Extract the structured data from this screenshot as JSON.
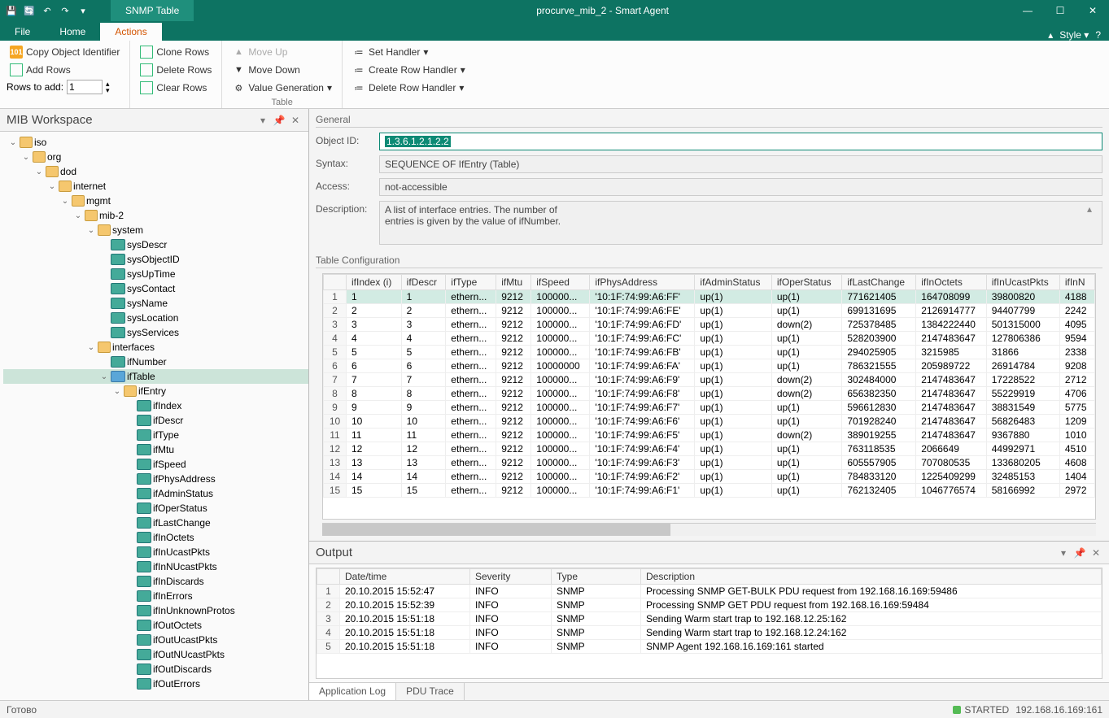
{
  "window": {
    "context_tab": "SNMP Table",
    "title": "procurve_mib_2 - Smart Agent",
    "style": "Style"
  },
  "menu": {
    "file": "File",
    "home": "Home",
    "actions": "Actions"
  },
  "ribbon": {
    "copy_oid": "Copy Object Identifier",
    "add_rows": "Add Rows",
    "rows_to_add": "Rows to add:",
    "rows_value": "1",
    "clone": "Clone Rows",
    "delete": "Delete Rows",
    "clear": "Clear Rows",
    "moveup": "Move Up",
    "movedown": "Move Down",
    "valgen": "Value Generation",
    "sethandler": "Set Handler",
    "createrow": "Create Row Handler",
    "deleterow": "Delete Row Handler",
    "grouplabel": "Table"
  },
  "mib": {
    "title": "MIB Workspace",
    "nodes": {
      "iso": "iso",
      "org": "org",
      "dod": "dod",
      "internet": "internet",
      "mgmt": "mgmt",
      "mib2": "mib-2",
      "system": "system",
      "sysDescr": "sysDescr",
      "sysObjectID": "sysObjectID",
      "sysUpTime": "sysUpTime",
      "sysContact": "sysContact",
      "sysName": "sysName",
      "sysLocation": "sysLocation",
      "sysServices": "sysServices",
      "interfaces": "interfaces",
      "ifNumber": "ifNumber",
      "ifTable": "ifTable",
      "ifEntry": "ifEntry",
      "ifIndex": "ifIndex",
      "ifDescr": "ifDescr",
      "ifType": "ifType",
      "ifMtu": "ifMtu",
      "ifSpeed": "ifSpeed",
      "ifPhysAddress": "ifPhysAddress",
      "ifAdminStatus": "ifAdminStatus",
      "ifOperStatus": "ifOperStatus",
      "ifLastChange": "ifLastChange",
      "ifInOctets": "ifInOctets",
      "ifInUcastPkts": "ifInUcastPkts",
      "ifInNUcastPkts": "ifInNUcastPkts",
      "ifInDiscards": "ifInDiscards",
      "ifInErrors": "ifInErrors",
      "ifInUnknownProtos": "ifInUnknownProtos",
      "ifOutOctets": "ifOutOctets",
      "ifOutUcastPkts": "ifOutUcastPkts",
      "ifOutNUcastPkts": "ifOutNUcastPkts",
      "ifOutDiscards": "ifOutDiscards",
      "ifOutErrors": "ifOutErrors"
    }
  },
  "general": {
    "title": "General",
    "object_id_lbl": "Object ID:",
    "object_id": "1.3.6.1.2.1.2.2",
    "syntax_lbl": "Syntax:",
    "syntax": "SEQUENCE OF IfEntry (Table)",
    "access_lbl": "Access:",
    "access": "not-accessible",
    "desc_lbl": "Description:",
    "desc": "A list of interface entries. The number of\nentries is given by the value of ifNumber."
  },
  "tablecfg": {
    "title": "Table Configuration",
    "cols": [
      "ifIndex (i)",
      "ifDescr",
      "ifType",
      "ifMtu",
      "ifSpeed",
      "ifPhysAddress",
      "ifAdminStatus",
      "ifOperStatus",
      "ifLastChange",
      "ifInOctets",
      "ifInUcastPkts",
      "ifInN"
    ],
    "rows": [
      [
        "1",
        "1",
        "ethern...",
        "9212",
        "100000...",
        "'10:1F:74:99:A6:FF'",
        "up(1)",
        "up(1)",
        "771621405",
        "164708099",
        "39800820",
        "4188"
      ],
      [
        "2",
        "2",
        "ethern...",
        "9212",
        "100000...",
        "'10:1F:74:99:A6:FE'",
        "up(1)",
        "up(1)",
        "699131695",
        "2126914777",
        "94407799",
        "2242"
      ],
      [
        "3",
        "3",
        "ethern...",
        "9212",
        "100000...",
        "'10:1F:74:99:A6:FD'",
        "up(1)",
        "down(2)",
        "725378485",
        "1384222440",
        "501315000",
        "4095"
      ],
      [
        "4",
        "4",
        "ethern...",
        "9212",
        "100000...",
        "'10:1F:74:99:A6:FC'",
        "up(1)",
        "up(1)",
        "528203900",
        "2147483647",
        "127806386",
        "9594"
      ],
      [
        "5",
        "5",
        "ethern...",
        "9212",
        "100000...",
        "'10:1F:74:99:A6:FB'",
        "up(1)",
        "up(1)",
        "294025905",
        "3215985",
        "31866",
        "2338"
      ],
      [
        "6",
        "6",
        "ethern...",
        "9212",
        "10000000",
        "'10:1F:74:99:A6:FA'",
        "up(1)",
        "up(1)",
        "786321555",
        "205989722",
        "26914784",
        "9208"
      ],
      [
        "7",
        "7",
        "ethern...",
        "9212",
        "100000...",
        "'10:1F:74:99:A6:F9'",
        "up(1)",
        "down(2)",
        "302484000",
        "2147483647",
        "17228522",
        "2712"
      ],
      [
        "8",
        "8",
        "ethern...",
        "9212",
        "100000...",
        "'10:1F:74:99:A6:F8'",
        "up(1)",
        "down(2)",
        "656382350",
        "2147483647",
        "55229919",
        "4706"
      ],
      [
        "9",
        "9",
        "ethern...",
        "9212",
        "100000...",
        "'10:1F:74:99:A6:F7'",
        "up(1)",
        "up(1)",
        "596612830",
        "2147483647",
        "38831549",
        "5775"
      ],
      [
        "10",
        "10",
        "ethern...",
        "9212",
        "100000...",
        "'10:1F:74:99:A6:F6'",
        "up(1)",
        "up(1)",
        "701928240",
        "2147483647",
        "56826483",
        "1209"
      ],
      [
        "11",
        "11",
        "ethern...",
        "9212",
        "100000...",
        "'10:1F:74:99:A6:F5'",
        "up(1)",
        "down(2)",
        "389019255",
        "2147483647",
        "9367880",
        "1010"
      ],
      [
        "12",
        "12",
        "ethern...",
        "9212",
        "100000...",
        "'10:1F:74:99:A6:F4'",
        "up(1)",
        "up(1)",
        "763118535",
        "2066649",
        "44992971",
        "4510"
      ],
      [
        "13",
        "13",
        "ethern...",
        "9212",
        "100000...",
        "'10:1F:74:99:A6:F3'",
        "up(1)",
        "up(1)",
        "605557905",
        "707080535",
        "133680205",
        "4608"
      ],
      [
        "14",
        "14",
        "ethern...",
        "9212",
        "100000...",
        "'10:1F:74:99:A6:F2'",
        "up(1)",
        "up(1)",
        "784833120",
        "1225409299",
        "32485153",
        "1404"
      ],
      [
        "15",
        "15",
        "ethern...",
        "9212",
        "100000...",
        "'10:1F:74:99:A6:F1'",
        "up(1)",
        "up(1)",
        "762132405",
        "1046776574",
        "58166992",
        "2972"
      ]
    ]
  },
  "output": {
    "title": "Output",
    "cols": [
      "Date/time",
      "Severity",
      "Type",
      "Description"
    ],
    "rows": [
      [
        "20.10.2015 15:52:47",
        "INFO",
        "SNMP",
        "Processing SNMP GET-BULK PDU request from 192.168.16.169:59486"
      ],
      [
        "20.10.2015 15:52:39",
        "INFO",
        "SNMP",
        "Processing SNMP GET PDU request from 192.168.16.169:59484"
      ],
      [
        "20.10.2015 15:51:18",
        "INFO",
        "SNMP",
        "Sending Warm start trap to 192.168.12.25:162"
      ],
      [
        "20.10.2015 15:51:18",
        "INFO",
        "SNMP",
        "Sending Warm start trap to 192.168.12.24:162"
      ],
      [
        "20.10.2015 15:51:18",
        "INFO",
        "SNMP",
        "SNMP Agent 192.168.16.169:161 started"
      ]
    ],
    "tab1": "Application Log",
    "tab2": "PDU Trace"
  },
  "status": {
    "ready": "Готово",
    "started": "STARTED",
    "addr": "192.168.16.169:161"
  }
}
